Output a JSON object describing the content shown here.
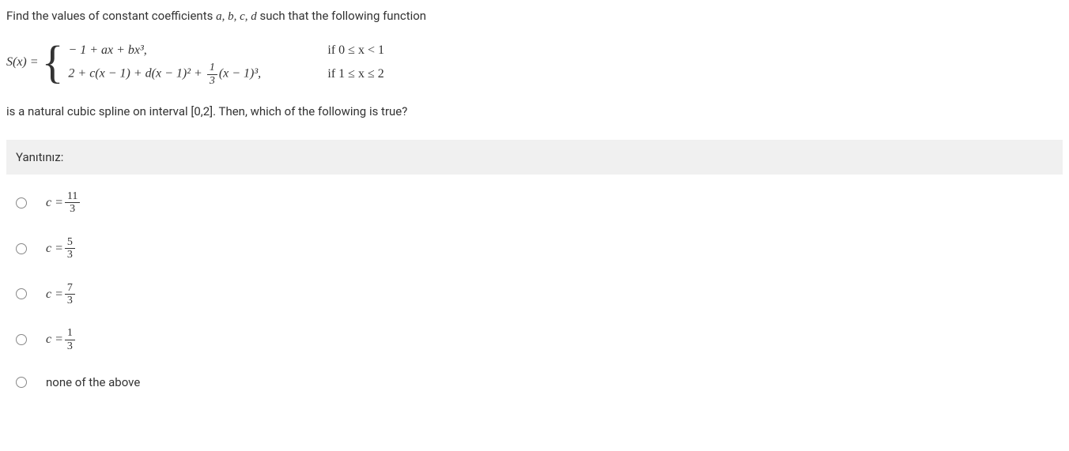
{
  "question": {
    "intro_before_vars": "Find the values of constant coefficients ",
    "vars": "a, b, c, d",
    "intro_after_vars": " such that the following function",
    "sx_label": "S(x) = ",
    "case1_formula": "− 1 + ax + bx³,",
    "case1_condition": "if  0 ≤ x < 1",
    "case2_part1": "2 + c(x − 1) + d(x − 1)² + ",
    "case2_frac_num": "1",
    "case2_frac_den": "3",
    "case2_part2": "(x − 1)³,",
    "case2_condition": "if  1 ≤ x ≤ 2",
    "closing": "is a natural cubic spline on interval [0,2]. Then, which of the following is true?"
  },
  "answer_header": "Yanıtınız:",
  "options": [
    {
      "prefix": "c = ",
      "num": "11",
      "den": "3",
      "is_frac": true
    },
    {
      "prefix": "c = ",
      "num": "5",
      "den": "3",
      "is_frac": true
    },
    {
      "prefix": "c = ",
      "num": "7",
      "den": "3",
      "is_frac": true
    },
    {
      "prefix": "c = ",
      "num": "1",
      "den": "3",
      "is_frac": true
    },
    {
      "text": "none of the above",
      "is_frac": false
    }
  ]
}
